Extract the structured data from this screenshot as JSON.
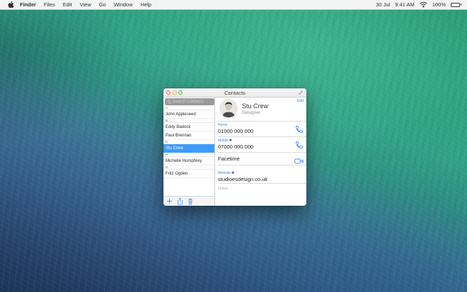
{
  "menu_bar": {
    "items": [
      "Finder",
      "Files",
      "Edit",
      "View",
      "Go",
      "Window",
      "Help"
    ],
    "status": {
      "date": "30 Jul",
      "time": "9:41 AM",
      "battery_percent": "100%"
    }
  },
  "window": {
    "title": "Contacts",
    "sidebar": {
      "search_placeholder": "Search Contacts",
      "sections": [
        {
          "letter": "A",
          "contacts": [
            {
              "name": "John Appleseed",
              "selected": false
            }
          ]
        },
        {
          "letter": "B",
          "contacts": [
            {
              "name": "Eddy Badock",
              "selected": false
            },
            {
              "name": "Paul Brennan",
              "selected": false
            }
          ]
        },
        {
          "letter": "C",
          "contacts": [
            {
              "name": "Stu Crew",
              "selected": true
            }
          ]
        },
        {
          "letter": "H",
          "contacts": [
            {
              "name": "Michelle Humphrey",
              "selected": false
            }
          ]
        },
        {
          "letter": "O",
          "contacts": [
            {
              "name": "Fritz Ogden",
              "selected": false
            }
          ]
        }
      ]
    },
    "detail": {
      "edit_label": "Edit",
      "name": "Stu Crew",
      "role": "Designer",
      "home": {
        "label": "Home",
        "marker": "",
        "value": "01000 000 000"
      },
      "mobile": {
        "label": "Mobile",
        "marker": "✱",
        "value": "07000 000 000"
      },
      "facetime": {
        "label": "Facetime"
      },
      "website": {
        "label": "Website",
        "marker": "✱",
        "value": "studioesdesign.co.uk"
      },
      "notes": {
        "label": "Notes"
      }
    }
  },
  "colors": {
    "selection_blue": "#3d9bfd",
    "link_blue": "#3f83f8",
    "traffic_close": "#f55e52",
    "traffic_minimize": "#f1b23a",
    "traffic_zoom": "#53bf4a",
    "wallpaper_green": "#2fa37f",
    "wallpaper_navy": "#1c3457"
  }
}
